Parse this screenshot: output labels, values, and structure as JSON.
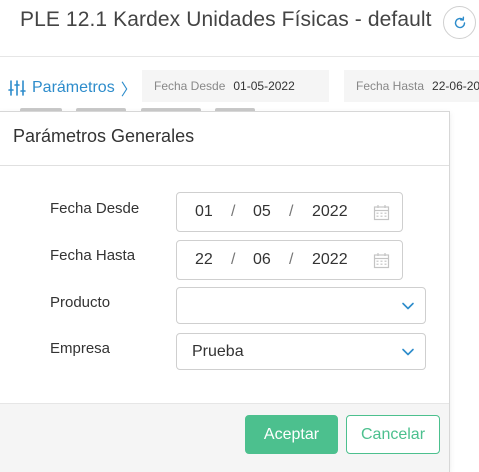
{
  "header": {
    "title": "PLE 12.1 Kardex Unidades Físicas - default",
    "refresh_icon": "refresh-icon"
  },
  "filters": {
    "params_label": "Parámetros",
    "params_icon": "sliders-icon",
    "chevron": "〉",
    "desde_label": "Fecha Desde",
    "desde_value": "01-05-2022",
    "hasta_label": "Fecha Hasta",
    "hasta_value": "22-06-20"
  },
  "modal": {
    "title": "Parámetros Generales",
    "fields": {
      "fecha_desde": {
        "label": "Fecha Desde",
        "day": "01",
        "month": "05",
        "year": "2022",
        "sep": "/"
      },
      "fecha_hasta": {
        "label": "Fecha Hasta",
        "day": "22",
        "month": "06",
        "year": "2022",
        "sep": "/"
      },
      "producto": {
        "label": "Producto",
        "value": ""
      },
      "empresa": {
        "label": "Empresa",
        "value": "Prueba"
      }
    },
    "buttons": {
      "accept": "Aceptar",
      "cancel": "Cancelar"
    }
  },
  "colors": {
    "accent": "#2d8ccb",
    "primary_button": "#4cc08e"
  }
}
